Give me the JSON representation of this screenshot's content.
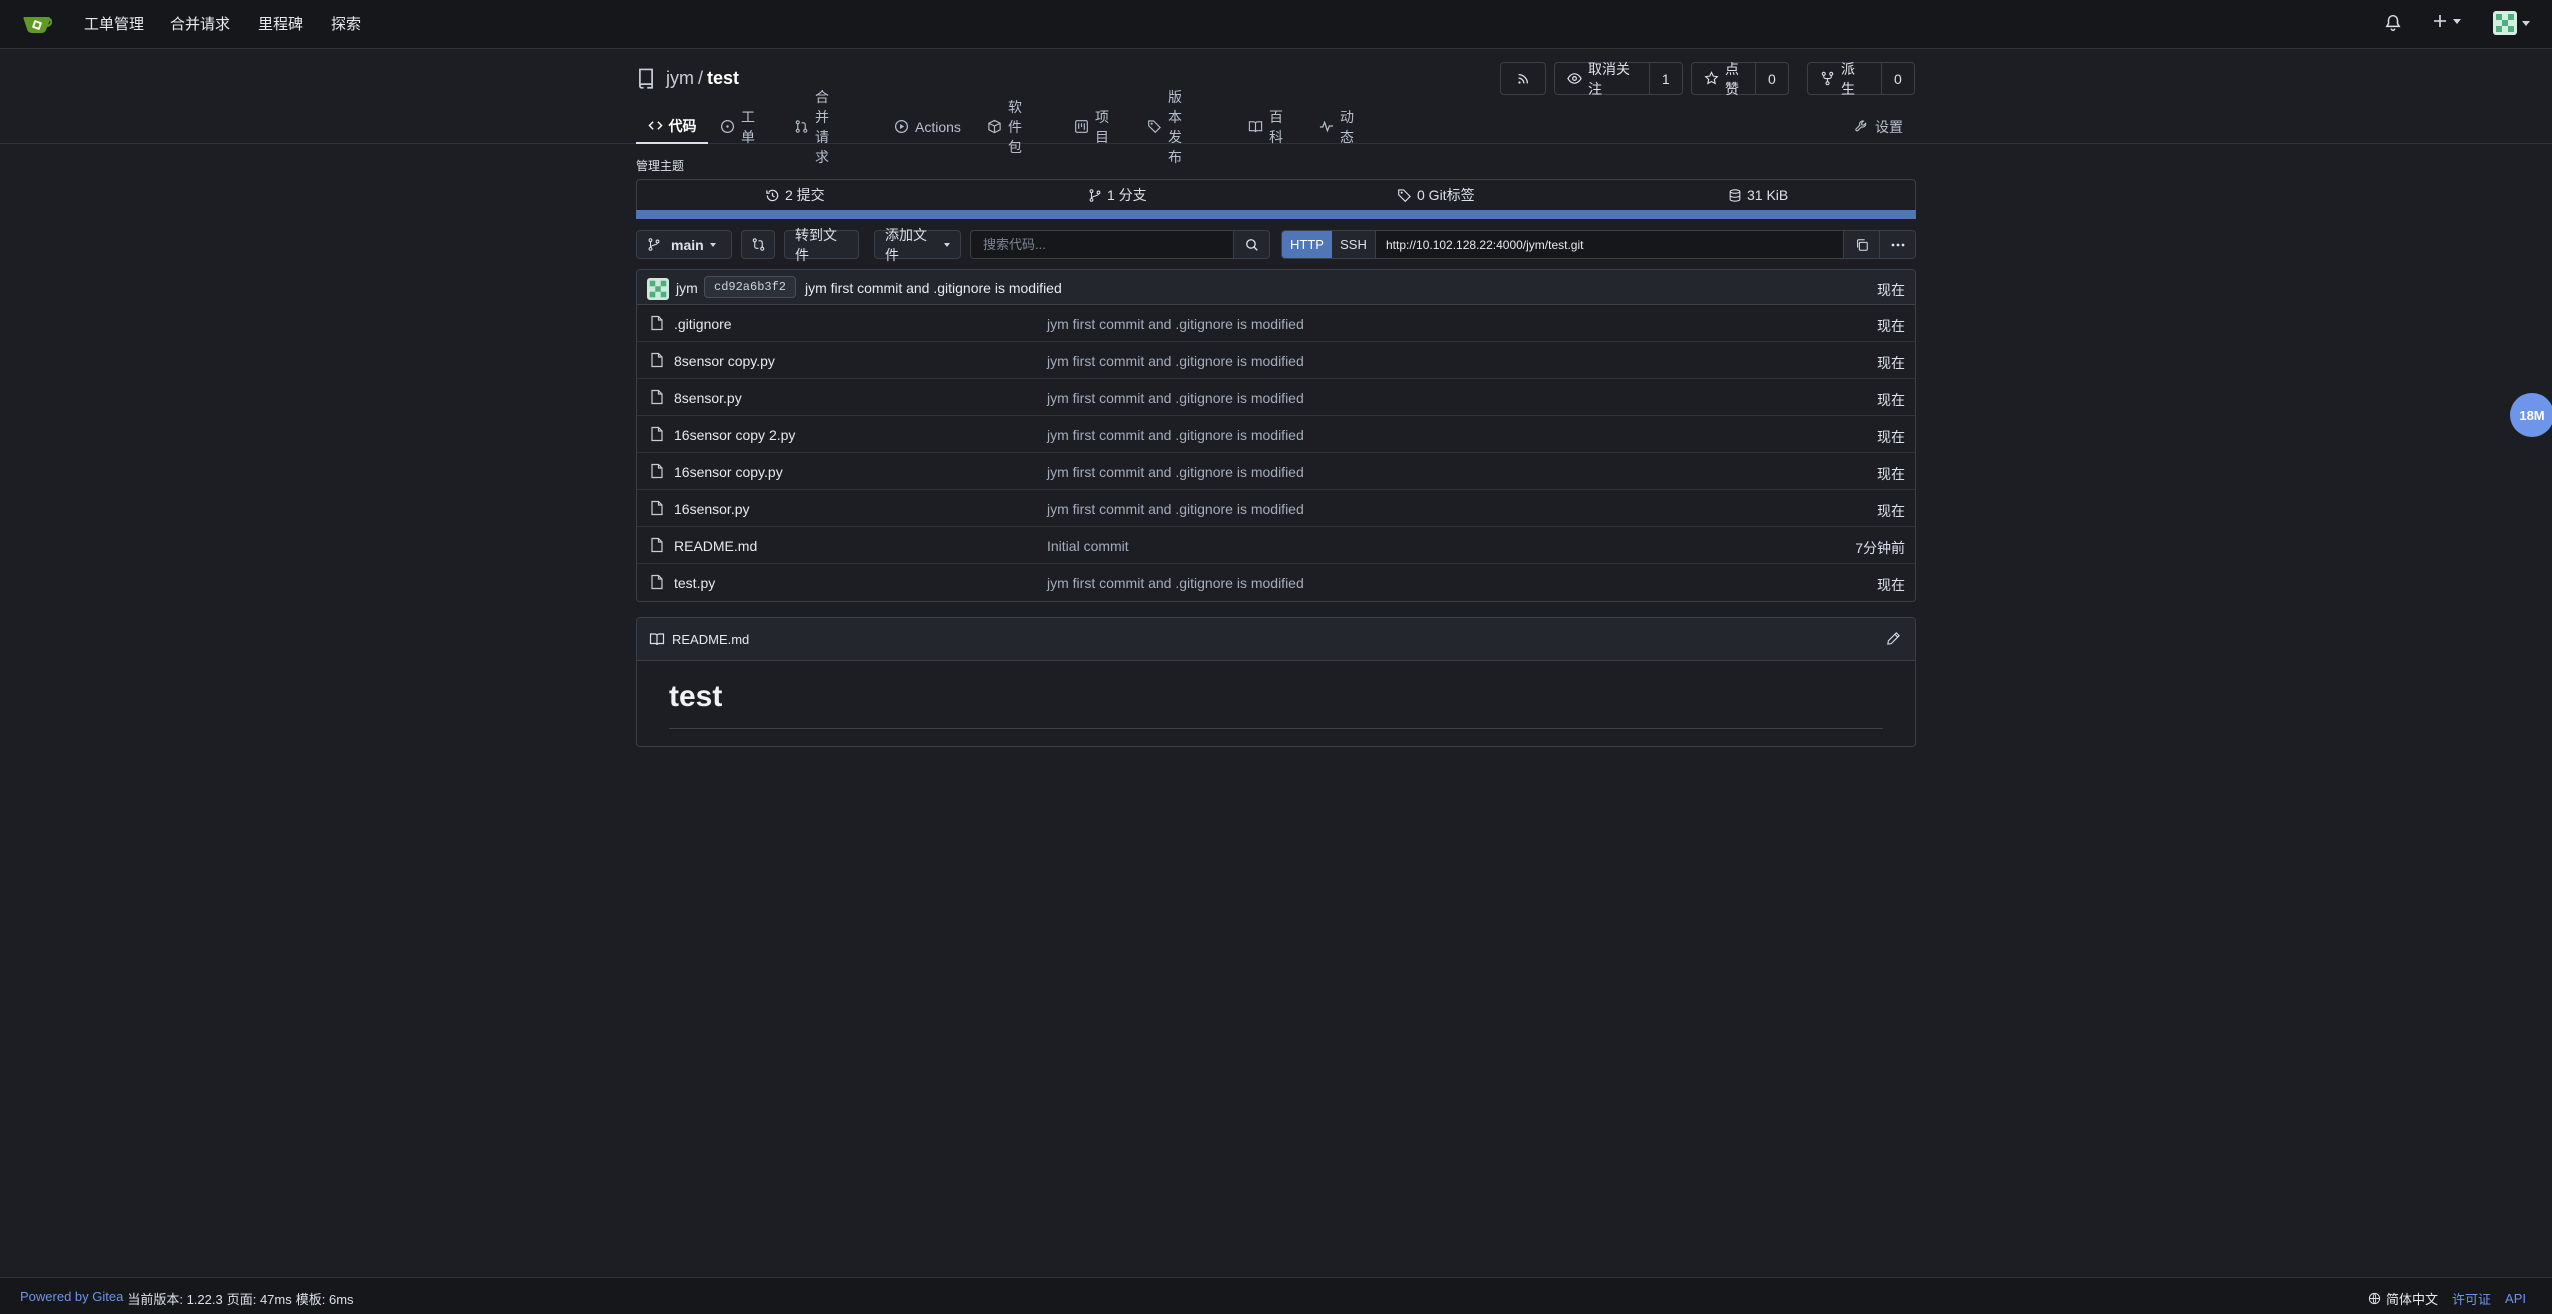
{
  "nav": {
    "items": [
      "工单管理",
      "合并请求",
      "里程碑",
      "探索"
    ]
  },
  "repo": {
    "owner": "jym",
    "separator": "/",
    "name": "test",
    "watch_label": "取消关注",
    "watch_count": "1",
    "star_label": "点赞",
    "star_count": "0",
    "fork_label": "派生",
    "fork_count": "0"
  },
  "tabs": {
    "code": "代码",
    "issues": "工单",
    "pulls": "合并请求",
    "actions": "Actions",
    "packages": "软件包",
    "projects": "项目",
    "releases": "版本发布",
    "wiki": "百科",
    "activity": "动态",
    "settings": "设置"
  },
  "manage_topics": "管理主题",
  "stats": {
    "commits": "2 提交",
    "branches": "1 分支",
    "tags": "0 Git标签",
    "size": "31 KiB",
    "language_bar_color": "#5176b8"
  },
  "toolbar": {
    "branch": "main",
    "goto_file": "转到文件",
    "add_file": "添加文件",
    "search_placeholder": "搜索代码...",
    "http": "HTTP",
    "ssh": "SSH",
    "clone_url": "http://10.102.128.22:4000/jym/test.git"
  },
  "latest_commit": {
    "author": "jym",
    "sha": "cd92a6b3f2",
    "message": "jym first commit and .gitignore is modified",
    "time": "现在"
  },
  "files": [
    {
      "name": ".gitignore",
      "message": "jym first commit and .gitignore is modified",
      "time": "现在"
    },
    {
      "name": "8sensor copy.py",
      "message": "jym first commit and .gitignore is modified",
      "time": "现在"
    },
    {
      "name": "8sensor.py",
      "message": "jym first commit and .gitignore is modified",
      "time": "现在"
    },
    {
      "name": "16sensor copy 2.py",
      "message": "jym first commit and .gitignore is modified",
      "time": "现在"
    },
    {
      "name": "16sensor copy.py",
      "message": "jym first commit and .gitignore is modified",
      "time": "现在"
    },
    {
      "name": "16sensor.py",
      "message": "jym first commit and .gitignore is modified",
      "time": "现在"
    },
    {
      "name": "README.md",
      "message": "Initial commit",
      "time": "7分钟前"
    },
    {
      "name": "test.py",
      "message": "jym first commit and .gitignore is modified",
      "time": "现在"
    }
  ],
  "readme": {
    "filename": "README.md",
    "heading": "test"
  },
  "float_badge": "18M",
  "footer": {
    "powered_by": "Powered by Gitea",
    "version": "当前版本: 1.22.3",
    "page": "页面: 47ms",
    "template": "模板: 6ms",
    "language": "简体中文",
    "license": "许可证",
    "api": "API"
  },
  "colors": {
    "accent": "#5176b8",
    "link": "#6d95ea",
    "background": "#1c1e23",
    "navbar": "#16171b"
  }
}
